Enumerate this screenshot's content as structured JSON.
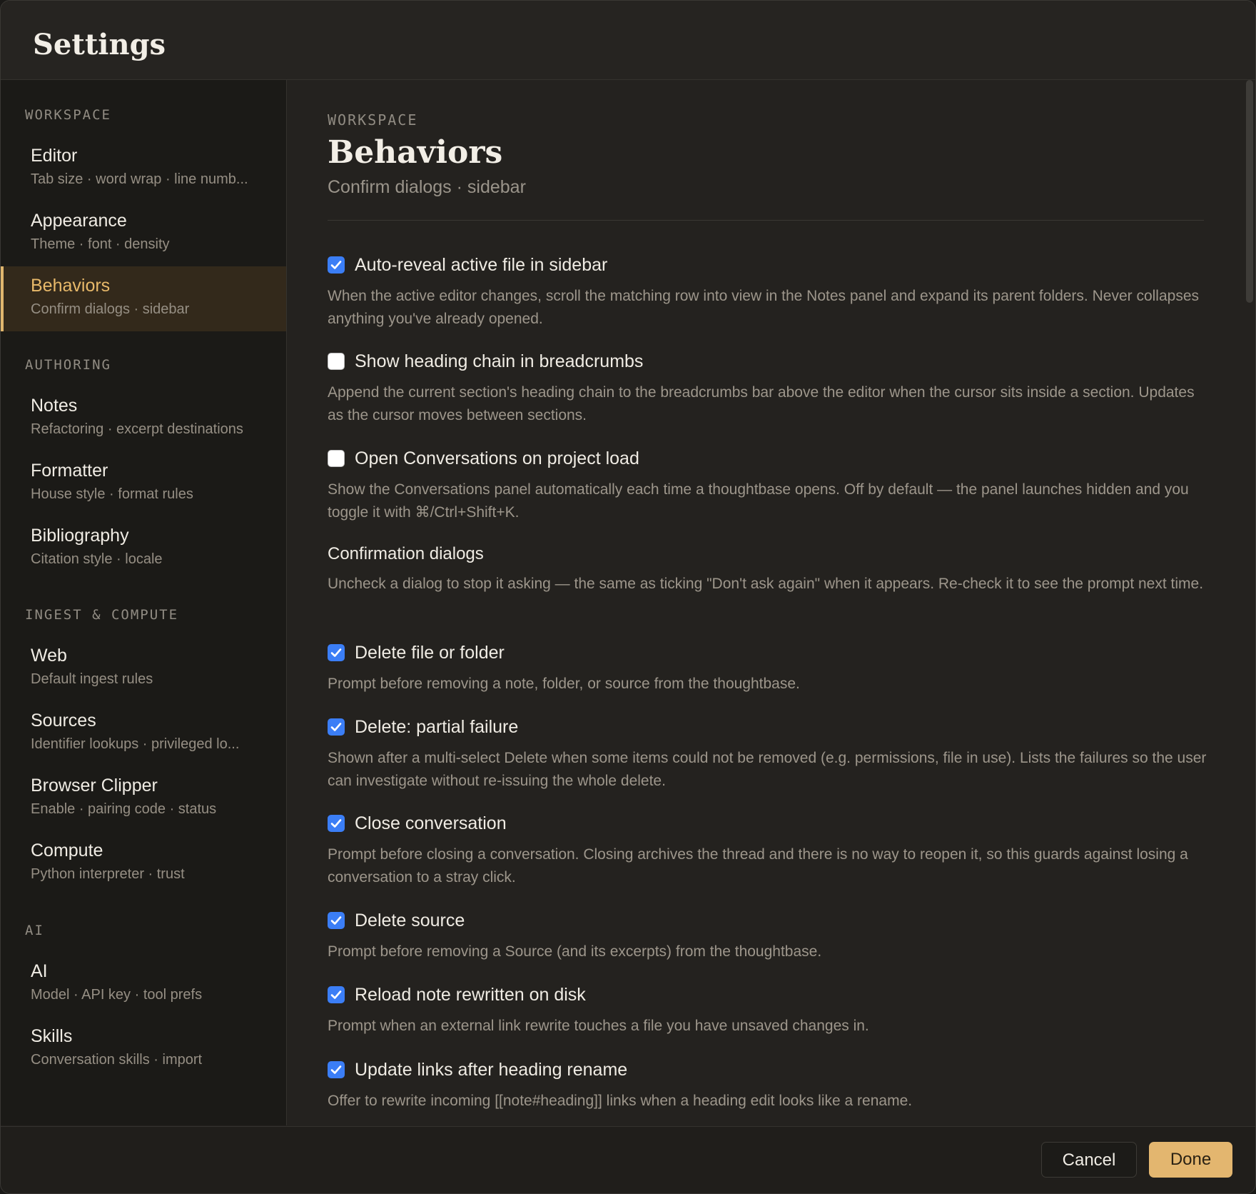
{
  "window": {
    "title": "Settings"
  },
  "sidebar": {
    "groups": [
      {
        "label": "WORKSPACE"
      },
      {
        "label": "AUTHORING"
      },
      {
        "label": "INGEST & COMPUTE"
      },
      {
        "label": "AI"
      }
    ],
    "items": [
      {
        "title": "Editor",
        "subtitle": "Tab size · word wrap · line numb..."
      },
      {
        "title": "Appearance",
        "subtitle": "Theme · font · density"
      },
      {
        "title": "Behaviors",
        "subtitle": "Confirm dialogs · sidebar"
      },
      {
        "title": "Notes",
        "subtitle": "Refactoring · excerpt destinations"
      },
      {
        "title": "Formatter",
        "subtitle": "House style · format rules"
      },
      {
        "title": "Bibliography",
        "subtitle": "Citation style · locale"
      },
      {
        "title": "Web",
        "subtitle": "Default ingest rules"
      },
      {
        "title": "Sources",
        "subtitle": "Identifier lookups · privileged lo..."
      },
      {
        "title": "Browser Clipper",
        "subtitle": "Enable · pairing code · status"
      },
      {
        "title": "Compute",
        "subtitle": "Python interpreter · trust"
      },
      {
        "title": "AI",
        "subtitle": "Model · API key · tool prefs"
      },
      {
        "title": "Skills",
        "subtitle": "Conversation skills · import"
      }
    ],
    "active_item": "Behaviors"
  },
  "main": {
    "eyebrow": "WORKSPACE",
    "title": "Behaviors",
    "subtitle": "Confirm dialogs · sidebar",
    "settings": [
      {
        "label": "Auto-reveal active file in sidebar",
        "checked": true,
        "description": "When the active editor changes, scroll the matching row into view in the Notes panel and expand its parent folders. Never collapses anything you've already opened."
      },
      {
        "label": "Show heading chain in breadcrumbs",
        "checked": false,
        "description": "Append the current section's heading chain to the breadcrumbs bar above the editor when the cursor sits inside a section. Updates as the cursor moves between sections."
      },
      {
        "label": "Open Conversations on project load",
        "checked": false,
        "description": "Show the Conversations panel automatically each time a thoughtbase opens. Off by default — the panel launches hidden and you toggle it with ⌘/Ctrl+Shift+K."
      }
    ],
    "confirmation": {
      "heading": "Confirmation dialogs",
      "description": "Uncheck a dialog to stop it asking — the same as ticking \"Don't ask again\" when it appears. Re-check it to see the prompt next time.",
      "items": [
        {
          "label": "Delete file or folder",
          "checked": true,
          "description": "Prompt before removing a note, folder, or source from the thoughtbase."
        },
        {
          "label": "Delete: partial failure",
          "checked": true,
          "description": "Shown after a multi-select Delete when some items could not be removed (e.g. permissions, file in use). Lists the failures so the user can investigate without re-issuing the whole delete."
        },
        {
          "label": "Close conversation",
          "checked": true,
          "description": "Prompt before closing a conversation. Closing archives the thread and there is no way to reopen it, so this guards against losing a conversation to a stray click."
        },
        {
          "label": "Delete source",
          "checked": true,
          "description": "Prompt before removing a Source (and its excerpts) from the thoughtbase."
        },
        {
          "label": "Reload note rewritten on disk",
          "checked": true,
          "description": "Prompt when an external link rewrite touches a file you have unsaved changes in."
        },
        {
          "label": "Update links after heading rename",
          "checked": true,
          "description": "Offer to rewrite incoming [[note#heading]] links when a heading edit looks like a rename."
        }
      ]
    }
  },
  "footer": {
    "cancel_label": "Cancel",
    "done_label": "Done"
  },
  "colors": {
    "accent": "#e3b66f",
    "checkbox": "#3b7ef6",
    "background": "#24221f"
  }
}
